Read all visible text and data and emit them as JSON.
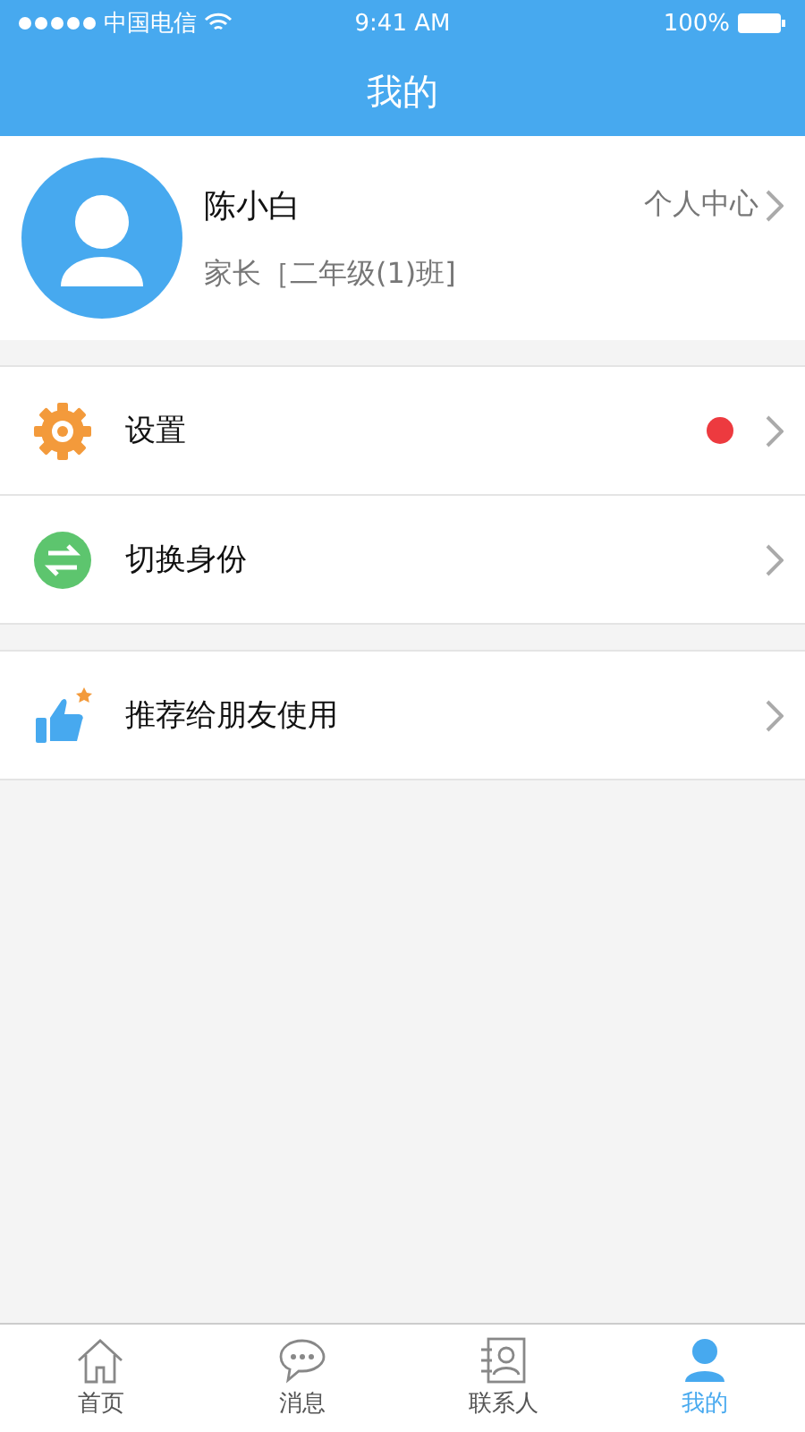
{
  "status_bar": {
    "carrier": "中国电信",
    "time": "9:41 AM",
    "battery": "100%"
  },
  "nav": {
    "title": "我的"
  },
  "profile": {
    "name": "陈小白",
    "role": "家长［二年级(1)班]",
    "link": "个人中心"
  },
  "sections": [
    {
      "items": [
        {
          "kind": "gear",
          "label": "设置",
          "badge": true
        },
        {
          "kind": "swap",
          "label": "切换身份",
          "badge": false
        }
      ]
    },
    {
      "items": [
        {
          "kind": "thumb",
          "label": "推荐给朋友使用",
          "badge": false
        }
      ]
    }
  ],
  "tabs": [
    {
      "kind": "home",
      "label": "首页",
      "selected": false
    },
    {
      "kind": "chat",
      "label": "消息",
      "selected": false
    },
    {
      "kind": "contacts",
      "label": "联系人",
      "selected": false
    },
    {
      "kind": "person",
      "label": "我的",
      "selected": true
    }
  ]
}
